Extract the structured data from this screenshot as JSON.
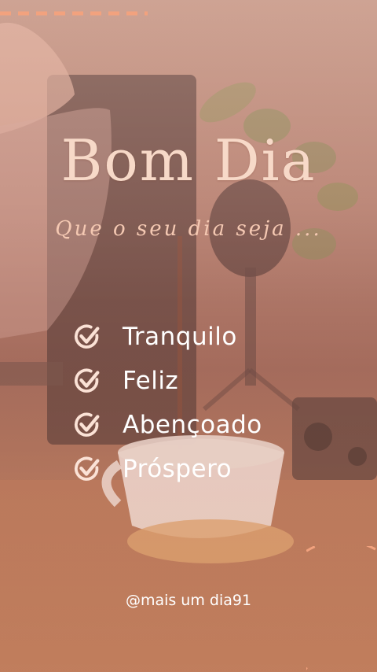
{
  "title": "Bom Dia",
  "subtitle": "Que o seu dia seja ...",
  "items": [
    {
      "label": "Tranquilo"
    },
    {
      "label": "Feliz"
    },
    {
      "label": "Abençoado"
    },
    {
      "label": "Próspero"
    }
  ],
  "handle": "@mais um dia91",
  "colors": {
    "accent": "#f2a27e",
    "title": "#f7d9c8",
    "text": "#ffffff"
  },
  "icons": [
    "check-circle-icon"
  ]
}
